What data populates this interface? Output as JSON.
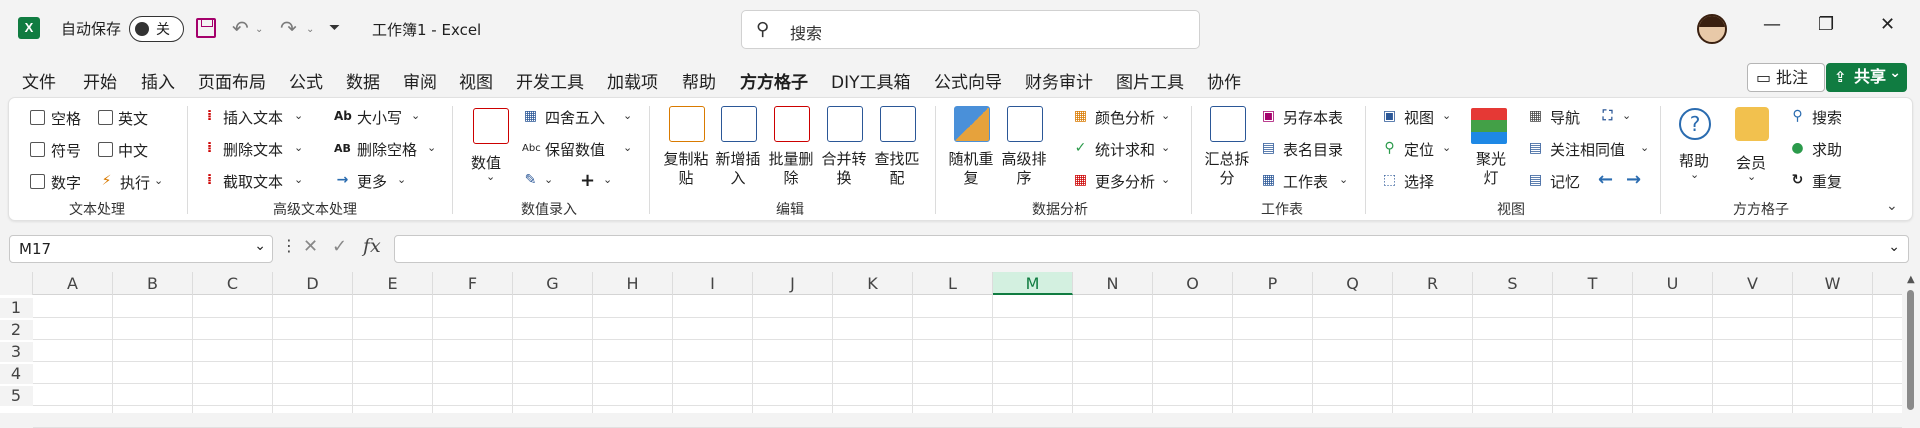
{
  "title_bar": {
    "app_logo": "X",
    "autosave_label": "自动保存",
    "autosave_state": "关",
    "document_title": "工作簿1 - Excel",
    "search_placeholder": "搜索"
  },
  "menu": [
    "文件",
    "开始",
    "插入",
    "页面布局",
    "公式",
    "数据",
    "审阅",
    "视图",
    "开发工具",
    "加载项",
    "帮助",
    "方方格子",
    "DIY工具箱",
    "公式向导",
    "财务审计",
    "图片工具",
    "协作"
  ],
  "active_menu": "方方格子",
  "right_buttons": {
    "comment": "批注",
    "share": "共享"
  },
  "ribbon": {
    "text_group": {
      "checkboxes": [
        "空格",
        "英文",
        "符号",
        "中文",
        "数字"
      ],
      "execute": "执行",
      "label": "文本处理"
    },
    "advanced_text": {
      "items": [
        "插入文本",
        "删除文本",
        "截取文本",
        "大小写",
        "删除空格",
        "更多"
      ],
      "label": "高级文本处理"
    },
    "numeric_input": {
      "value_button": "数值",
      "items": [
        "四舍五入",
        "保留数值"
      ],
      "label": "数值录入"
    },
    "edit": {
      "buttons": [
        "复制粘贴",
        "新增插入",
        "批量删除",
        "合并转换",
        "查找匹配"
      ],
      "label": "编辑"
    },
    "data_analysis": {
      "buttons": [
        "随机重复",
        "高级排序"
      ],
      "items": [
        "颜色分析",
        "统计求和",
        "更多分析"
      ],
      "label": "数据分析"
    },
    "worksheet": {
      "button": "汇总拆分",
      "items": [
        "另存本表",
        "表名目录",
        "工作表"
      ],
      "label": "工作表"
    },
    "view": {
      "items": [
        "视图",
        "定位",
        "选择",
        "导航",
        "关注相同值",
        "记忆"
      ],
      "spotlight": "聚光灯",
      "label": "视图"
    },
    "fangfang": {
      "buttons": [
        "帮助",
        "会员"
      ],
      "items": [
        "搜索",
        "求助",
        "重复"
      ],
      "label": "方方格子"
    }
  },
  "formula_bar": {
    "name_box": "M17",
    "fx": "fx",
    "formula": ""
  },
  "columns": [
    "A",
    "B",
    "C",
    "D",
    "E",
    "F",
    "G",
    "H",
    "I",
    "J",
    "K",
    "L",
    "M",
    "N",
    "O",
    "P",
    "Q",
    "R",
    "S",
    "T",
    "U",
    "V",
    "W"
  ],
  "selected_column": "M",
  "rows": [
    "1",
    "2",
    "3",
    "4",
    "5"
  ]
}
